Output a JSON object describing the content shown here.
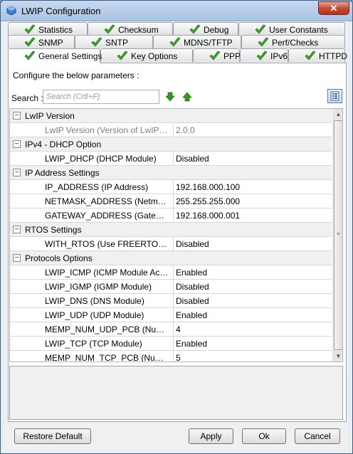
{
  "window": {
    "title": "LWIP Configuration",
    "close_glyph": "✕"
  },
  "tabs": {
    "row1": [
      {
        "label": "Statistics"
      },
      {
        "label": "Checksum"
      },
      {
        "label": "Debug"
      },
      {
        "label": "User Constants"
      }
    ],
    "row2": [
      {
        "label": "SNMP"
      },
      {
        "label": "SNTP"
      },
      {
        "label": "MDNS/TFTP"
      },
      {
        "label": "Perf/Checks"
      }
    ],
    "row3": [
      {
        "label": "General Settings",
        "active": true
      },
      {
        "label": "Key Options"
      },
      {
        "label": "PPP"
      },
      {
        "label": "IPv6"
      },
      {
        "label": "HTTPD"
      }
    ]
  },
  "panel": {
    "intro": "Configure the below parameters :",
    "search_label": "Search :",
    "search_placeholder": "Search (Crtl+F)"
  },
  "grid": {
    "rows": [
      {
        "type": "cat",
        "name": "LwIP Version"
      },
      {
        "type": "param",
        "name": "LwIP Version (Version of LwIP sup...",
        "value": "2.0.0",
        "disabled": true
      },
      {
        "type": "cat",
        "name": "IPv4 - DHCP Option"
      },
      {
        "type": "param",
        "name": "LWIP_DHCP (DHCP Module)",
        "value": "Disabled"
      },
      {
        "type": "cat",
        "name": "IP Address Settings"
      },
      {
        "type": "param",
        "name": "IP_ADDRESS (IP Address)",
        "value": "192.168.000.100"
      },
      {
        "type": "param",
        "name": "NETMASK_ADDRESS (Netmask Ad...",
        "value": "255.255.255.000"
      },
      {
        "type": "param",
        "name": "GATEWAY_ADDRESS (Gateway A...",
        "value": "192.168.000.001"
      },
      {
        "type": "cat",
        "name": "RTOS Settings"
      },
      {
        "type": "param",
        "name": "WITH_RTOS (Use FREERTOS ** ...",
        "value": "Disabled"
      },
      {
        "type": "cat",
        "name": "Protocols Options"
      },
      {
        "type": "param",
        "name": "LWIP_ICMP (ICMP Module Activati...",
        "value": "Enabled"
      },
      {
        "type": "param",
        "name": "LWIP_IGMP (IGMP Module)",
        "value": "Disabled"
      },
      {
        "type": "param",
        "name": "LWIP_DNS (DNS Module)",
        "value": "Disabled"
      },
      {
        "type": "param",
        "name": "LWIP_UDP (UDP Module)",
        "value": "Enabled"
      },
      {
        "type": "param",
        "name": "MEMP_NUM_UDP_PCB (Number of...",
        "value": "4"
      },
      {
        "type": "param",
        "name": "LWIP_TCP (TCP Module)",
        "value": "Enabled"
      },
      {
        "type": "param",
        "name": "MEMP_NUM_TCP_PCB (Number of...",
        "value": "5"
      }
    ],
    "collapse_glyph": "−"
  },
  "buttons": {
    "restore": "Restore Default",
    "apply": "Apply",
    "ok": "Ok",
    "cancel": "Cancel"
  },
  "colors": {
    "check_green": "#3aa52d",
    "arrow_green": "#2f9a1d"
  },
  "icons": {
    "tab_status": "checkmark-icon",
    "search_next": "arrow-down-icon",
    "search_prev": "arrow-up-icon",
    "view_toggle": "list-view-icon",
    "window": "cube-icon"
  }
}
